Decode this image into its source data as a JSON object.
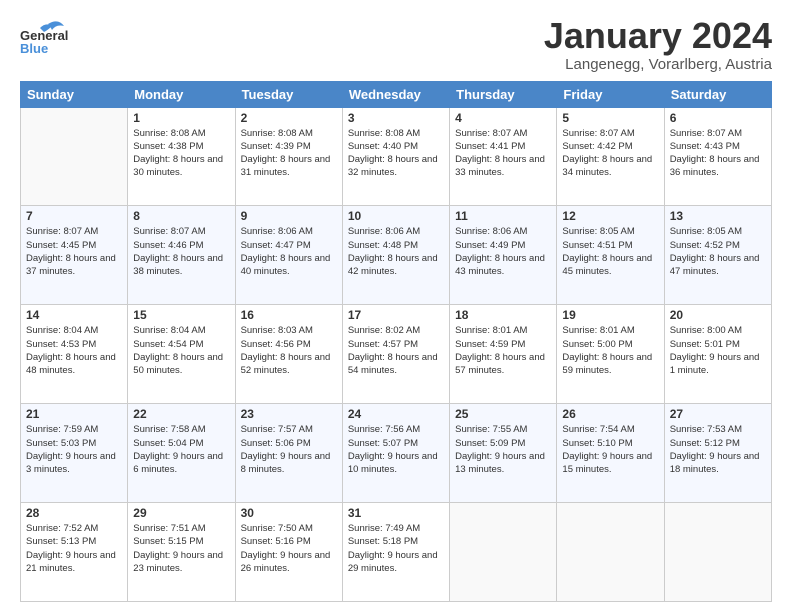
{
  "logo": {
    "line1": "General",
    "line2": "Blue"
  },
  "header": {
    "title": "January 2024",
    "subtitle": "Langenegg, Vorarlberg, Austria"
  },
  "weekdays": [
    "Sunday",
    "Monday",
    "Tuesday",
    "Wednesday",
    "Thursday",
    "Friday",
    "Saturday"
  ],
  "weeks": [
    [
      {
        "day": "",
        "sunrise": "",
        "sunset": "",
        "daylight": ""
      },
      {
        "day": "1",
        "sunrise": "Sunrise: 8:08 AM",
        "sunset": "Sunset: 4:38 PM",
        "daylight": "Daylight: 8 hours and 30 minutes."
      },
      {
        "day": "2",
        "sunrise": "Sunrise: 8:08 AM",
        "sunset": "Sunset: 4:39 PM",
        "daylight": "Daylight: 8 hours and 31 minutes."
      },
      {
        "day": "3",
        "sunrise": "Sunrise: 8:08 AM",
        "sunset": "Sunset: 4:40 PM",
        "daylight": "Daylight: 8 hours and 32 minutes."
      },
      {
        "day": "4",
        "sunrise": "Sunrise: 8:07 AM",
        "sunset": "Sunset: 4:41 PM",
        "daylight": "Daylight: 8 hours and 33 minutes."
      },
      {
        "day": "5",
        "sunrise": "Sunrise: 8:07 AM",
        "sunset": "Sunset: 4:42 PM",
        "daylight": "Daylight: 8 hours and 34 minutes."
      },
      {
        "day": "6",
        "sunrise": "Sunrise: 8:07 AM",
        "sunset": "Sunset: 4:43 PM",
        "daylight": "Daylight: 8 hours and 36 minutes."
      }
    ],
    [
      {
        "day": "7",
        "sunrise": "Sunrise: 8:07 AM",
        "sunset": "Sunset: 4:45 PM",
        "daylight": "Daylight: 8 hours and 37 minutes."
      },
      {
        "day": "8",
        "sunrise": "Sunrise: 8:07 AM",
        "sunset": "Sunset: 4:46 PM",
        "daylight": "Daylight: 8 hours and 38 minutes."
      },
      {
        "day": "9",
        "sunrise": "Sunrise: 8:06 AM",
        "sunset": "Sunset: 4:47 PM",
        "daylight": "Daylight: 8 hours and 40 minutes."
      },
      {
        "day": "10",
        "sunrise": "Sunrise: 8:06 AM",
        "sunset": "Sunset: 4:48 PM",
        "daylight": "Daylight: 8 hours and 42 minutes."
      },
      {
        "day": "11",
        "sunrise": "Sunrise: 8:06 AM",
        "sunset": "Sunset: 4:49 PM",
        "daylight": "Daylight: 8 hours and 43 minutes."
      },
      {
        "day": "12",
        "sunrise": "Sunrise: 8:05 AM",
        "sunset": "Sunset: 4:51 PM",
        "daylight": "Daylight: 8 hours and 45 minutes."
      },
      {
        "day": "13",
        "sunrise": "Sunrise: 8:05 AM",
        "sunset": "Sunset: 4:52 PM",
        "daylight": "Daylight: 8 hours and 47 minutes."
      }
    ],
    [
      {
        "day": "14",
        "sunrise": "Sunrise: 8:04 AM",
        "sunset": "Sunset: 4:53 PM",
        "daylight": "Daylight: 8 hours and 48 minutes."
      },
      {
        "day": "15",
        "sunrise": "Sunrise: 8:04 AM",
        "sunset": "Sunset: 4:54 PM",
        "daylight": "Daylight: 8 hours and 50 minutes."
      },
      {
        "day": "16",
        "sunrise": "Sunrise: 8:03 AM",
        "sunset": "Sunset: 4:56 PM",
        "daylight": "Daylight: 8 hours and 52 minutes."
      },
      {
        "day": "17",
        "sunrise": "Sunrise: 8:02 AM",
        "sunset": "Sunset: 4:57 PM",
        "daylight": "Daylight: 8 hours and 54 minutes."
      },
      {
        "day": "18",
        "sunrise": "Sunrise: 8:01 AM",
        "sunset": "Sunset: 4:59 PM",
        "daylight": "Daylight: 8 hours and 57 minutes."
      },
      {
        "day": "19",
        "sunrise": "Sunrise: 8:01 AM",
        "sunset": "Sunset: 5:00 PM",
        "daylight": "Daylight: 8 hours and 59 minutes."
      },
      {
        "day": "20",
        "sunrise": "Sunrise: 8:00 AM",
        "sunset": "Sunset: 5:01 PM",
        "daylight": "Daylight: 9 hours and 1 minute."
      }
    ],
    [
      {
        "day": "21",
        "sunrise": "Sunrise: 7:59 AM",
        "sunset": "Sunset: 5:03 PM",
        "daylight": "Daylight: 9 hours and 3 minutes."
      },
      {
        "day": "22",
        "sunrise": "Sunrise: 7:58 AM",
        "sunset": "Sunset: 5:04 PM",
        "daylight": "Daylight: 9 hours and 6 minutes."
      },
      {
        "day": "23",
        "sunrise": "Sunrise: 7:57 AM",
        "sunset": "Sunset: 5:06 PM",
        "daylight": "Daylight: 9 hours and 8 minutes."
      },
      {
        "day": "24",
        "sunrise": "Sunrise: 7:56 AM",
        "sunset": "Sunset: 5:07 PM",
        "daylight": "Daylight: 9 hours and 10 minutes."
      },
      {
        "day": "25",
        "sunrise": "Sunrise: 7:55 AM",
        "sunset": "Sunset: 5:09 PM",
        "daylight": "Daylight: 9 hours and 13 minutes."
      },
      {
        "day": "26",
        "sunrise": "Sunrise: 7:54 AM",
        "sunset": "Sunset: 5:10 PM",
        "daylight": "Daylight: 9 hours and 15 minutes."
      },
      {
        "day": "27",
        "sunrise": "Sunrise: 7:53 AM",
        "sunset": "Sunset: 5:12 PM",
        "daylight": "Daylight: 9 hours and 18 minutes."
      }
    ],
    [
      {
        "day": "28",
        "sunrise": "Sunrise: 7:52 AM",
        "sunset": "Sunset: 5:13 PM",
        "daylight": "Daylight: 9 hours and 21 minutes."
      },
      {
        "day": "29",
        "sunrise": "Sunrise: 7:51 AM",
        "sunset": "Sunset: 5:15 PM",
        "daylight": "Daylight: 9 hours and 23 minutes."
      },
      {
        "day": "30",
        "sunrise": "Sunrise: 7:50 AM",
        "sunset": "Sunset: 5:16 PM",
        "daylight": "Daylight: 9 hours and 26 minutes."
      },
      {
        "day": "31",
        "sunrise": "Sunrise: 7:49 AM",
        "sunset": "Sunset: 5:18 PM",
        "daylight": "Daylight: 9 hours and 29 minutes."
      },
      {
        "day": "",
        "sunrise": "",
        "sunset": "",
        "daylight": ""
      },
      {
        "day": "",
        "sunrise": "",
        "sunset": "",
        "daylight": ""
      },
      {
        "day": "",
        "sunrise": "",
        "sunset": "",
        "daylight": ""
      }
    ]
  ]
}
